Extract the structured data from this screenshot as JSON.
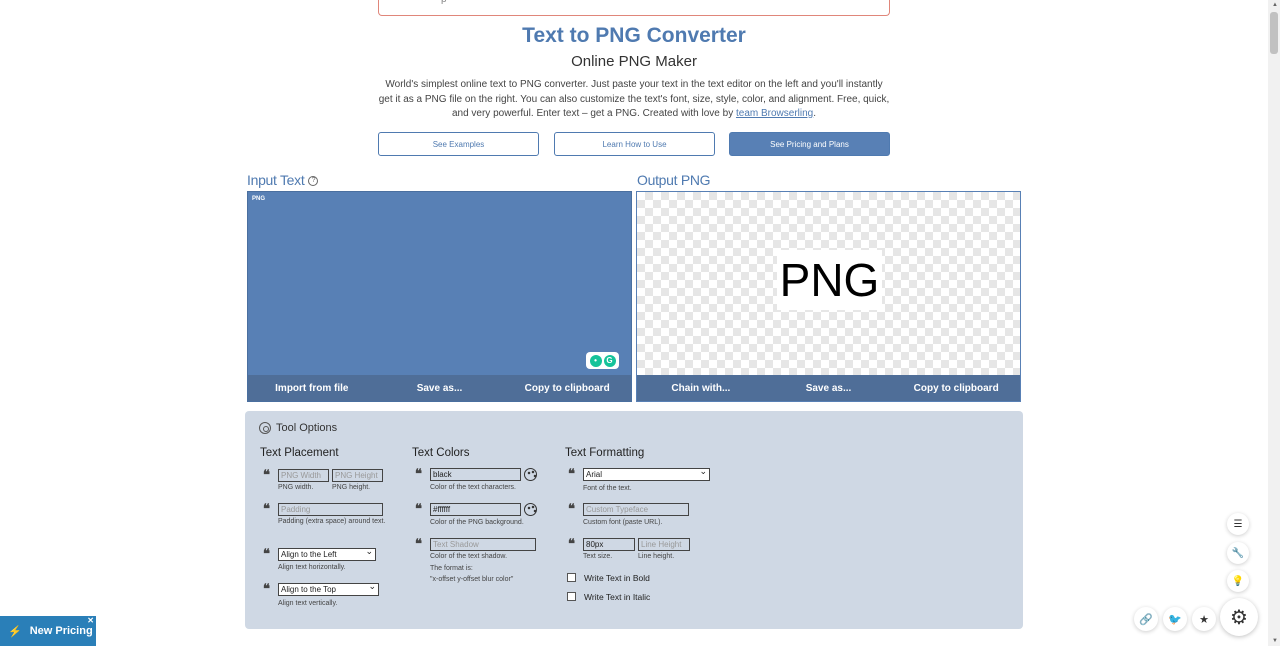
{
  "banner": {
    "text": "p"
  },
  "header": {
    "title": "Text to PNG Converter",
    "subtitle": "Online PNG Maker",
    "description": "World's simplest online text to PNG converter. Just paste your text in the text editor on the left and you'll instantly get it as a PNG file on the right. You can also customize the text's font, size, style, color, and alignment. Free, quick, and very powerful. Enter text – get a PNG. Created with love by ",
    "link_text": "team Browserling",
    "period": "."
  },
  "buttons": {
    "examples": "See Examples",
    "howto": "Learn How to Use",
    "pricing": "See Pricing and Plans"
  },
  "input": {
    "title": "Input Text",
    "help": "?",
    "text": "PNG",
    "actions": [
      "Import from file",
      "Save as...",
      "Copy to clipboard"
    ]
  },
  "output": {
    "title": "Output PNG",
    "preview": "PNG",
    "actions": [
      "Chain with...",
      "Save as...",
      "Copy to clipboard"
    ]
  },
  "tool_options": {
    "title": "Tool Options",
    "placement": {
      "title": "Text Placement",
      "width_ph": "PNG Width",
      "height_ph": "PNG Height",
      "width_hint": "PNG width.",
      "height_hint": "PNG height.",
      "padding_ph": "Padding",
      "padding_hint": "Padding (extra space) around text.",
      "halign": "Align to the Left",
      "halign_hint": "Align text horizontally.",
      "valign": "Align to the Top",
      "valign_hint": "Align text vertically."
    },
    "colors": {
      "title": "Text Colors",
      "text_color": "black",
      "text_color_hint": "Color of the text characters.",
      "bg_color": "#ffffff",
      "bg_color_hint": "Color of the PNG background.",
      "shadow_ph": "Text Shadow",
      "shadow_hint": "Color of the text shadow.",
      "shadow_format1": "The format is:",
      "shadow_format2": "\"x-offset y-offset blur color\""
    },
    "formatting": {
      "title": "Text Formatting",
      "font": "Arial",
      "font_hint": "Font of the text.",
      "custom_ph": "Custom Typeface",
      "custom_hint": "Custom font (paste URL).",
      "size": "80px",
      "size_hint": "Text size.",
      "lineheight_ph": "Line Height",
      "lineheight_hint": "Line height.",
      "bold": "Write Text in Bold",
      "italic": "Write Text in Italic"
    }
  },
  "promo": {
    "label": "New Pricing",
    "close": "✕"
  },
  "colors": {
    "accent": "#4f7ab0",
    "panel": "#5880b5",
    "bar": "#4f6e98",
    "options_bg": "#cfd8e4"
  }
}
